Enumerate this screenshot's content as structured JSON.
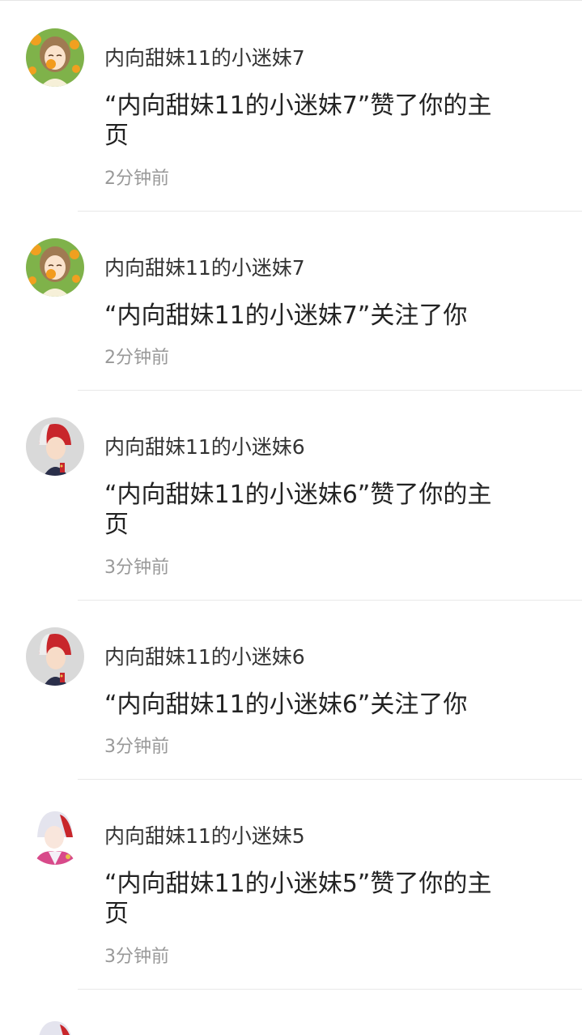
{
  "notifications": [
    {
      "username": "内向甜妹11的小迷妹7",
      "message": "“内向甜妹11的小迷妹7”赞了你的主页",
      "time": "2分钟前",
      "avatar": "avatar-girl-orange"
    },
    {
      "username": "内向甜妹11的小迷妹7",
      "message": "“内向甜妹11的小迷妹7”关注了你",
      "time": "2分钟前",
      "avatar": "avatar-girl-orange"
    },
    {
      "username": "内向甜妹11的小迷妹6",
      "message": "“内向甜妹11的小迷妹6”赞了你的主页",
      "time": "3分钟前",
      "avatar": "avatar-boy-red"
    },
    {
      "username": "内向甜妹11的小迷妹6",
      "message": "“内向甜妹11的小迷妹6”关注了你",
      "time": "3分钟前",
      "avatar": "avatar-boy-red"
    },
    {
      "username": "内向甜妹11的小迷妹5",
      "message": "“内向甜妹11的小迷妹5”赞了你的主页",
      "time": "3分钟前",
      "avatar": "avatar-boy-white"
    }
  ]
}
